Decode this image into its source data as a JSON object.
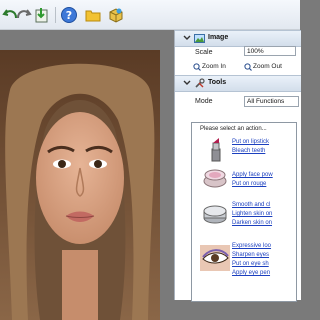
{
  "toolbar": {
    "buttons": [
      {
        "name": "undo-icon"
      },
      {
        "name": "redo-icon"
      },
      {
        "name": "export-icon"
      },
      {
        "name": "help-icon"
      },
      {
        "name": "folder-icon"
      },
      {
        "name": "box-icon"
      }
    ]
  },
  "image_section": {
    "title": "Image",
    "scale_label": "Scale",
    "scale_value": "100%",
    "zoom_in_label": "Zoom In",
    "zoom_out_label": "Zoom Out"
  },
  "tools_section": {
    "title": "Tools",
    "mode_label": "Mode",
    "mode_value": "All Functions"
  },
  "actions_panel": {
    "prompt": "Please select an action...",
    "groups": [
      {
        "thumb": "lipstick-icon",
        "links": [
          "Put on lipstick",
          "Bleach teeth"
        ]
      },
      {
        "thumb": "powder-compact-icon",
        "links": [
          "Apply face pow",
          "Put on rouge"
        ]
      },
      {
        "thumb": "foundation-jar-icon",
        "links": [
          "Smooth and cl",
          "Lighten skin on",
          "Darken skin on"
        ]
      },
      {
        "thumb": "eye-makeup-icon",
        "links": [
          "Expressive loo",
          "Sharpen eyes",
          "Put on eye sh",
          "Apply eye pen"
        ]
      }
    ]
  },
  "colors": {
    "canvas_bg": "#7a7a7a",
    "panel_header": "#d3deeb",
    "link": "#1b3fbf"
  }
}
